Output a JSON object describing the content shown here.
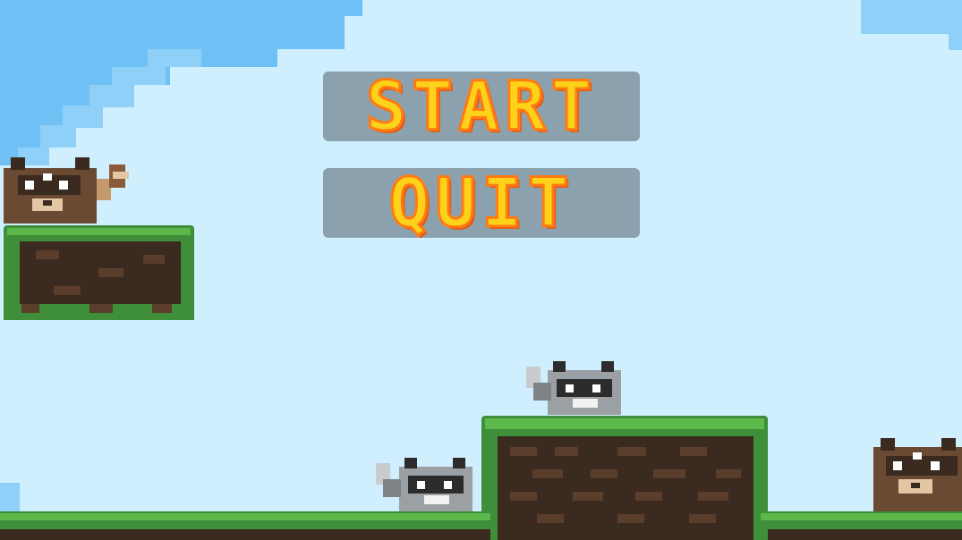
{
  "menu": {
    "start_label": "START",
    "quit_label": "QUIT"
  },
  "colors": {
    "sky_light": "#cfefff",
    "sky_blue": "#6fc1f5",
    "sky_mid": "#8fd0f8",
    "grass": "#3e8e3a",
    "grass_light": "#5cb84a",
    "dirt": "#3a2a1f",
    "dirt_light": "#5a3d2a",
    "button_bg": "#6e828c",
    "button_text": "#ffd21a",
    "button_outline": "#ff7a14"
  },
  "sprites": {
    "player": "brown-raccoon-icon",
    "enemy": "gray-raccoon-icon"
  }
}
